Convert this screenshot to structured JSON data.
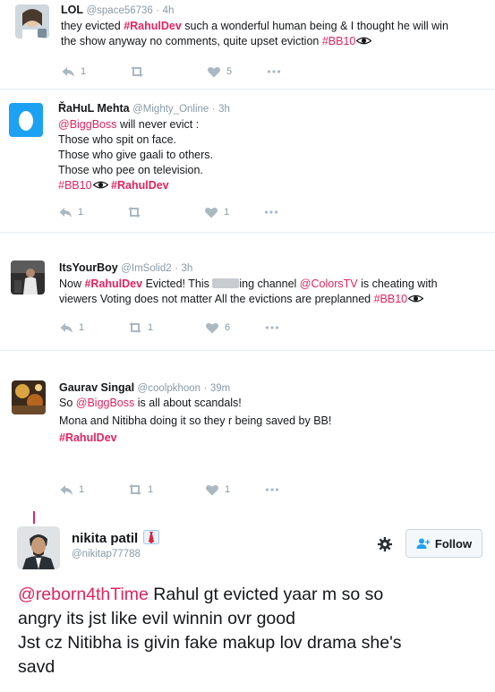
{
  "tweets": [
    {
      "name": "LOL",
      "handle": "@space56736",
      "time": "4h",
      "lines": [
        [
          {
            "t": "they evicted ",
            "c": "text"
          },
          {
            "t": "#RahulDev",
            "c": "hl"
          },
          {
            "t": " such a wonderful human being & I thought he will win",
            "c": "text"
          }
        ],
        [
          {
            "t": "the show anyway no comments, quite upset eviction ",
            "c": "text"
          },
          {
            "t": "#BB10",
            "c": "mention"
          },
          {
            "t": "",
            "c": "eye"
          }
        ]
      ],
      "reply_count": "1",
      "retweet_count": "",
      "like_count": "5"
    },
    {
      "name": "ŘaHuL Mehta",
      "handle": "@Mighty_Online",
      "time": "3h",
      "lines": [
        [
          {
            "t": "@BiggBoss",
            "c": "mention"
          },
          {
            "t": " will never evict :",
            "c": "text"
          }
        ],
        [
          {
            "t": "Those who spit on face.",
            "c": "text"
          }
        ],
        [
          {
            "t": "Those who give gaali to others.",
            "c": "text"
          }
        ],
        [
          {
            "t": "Those who pee on television.",
            "c": "text"
          }
        ],
        [
          {
            "t": "#BB10",
            "c": "mention"
          },
          {
            "t": "",
            "c": "eye"
          },
          {
            "t": " ",
            "c": "text"
          },
          {
            "t": "#RahulDev",
            "c": "hl"
          }
        ]
      ],
      "reply_count": "1",
      "retweet_count": "",
      "like_count": "1"
    },
    {
      "name": "ItsYourBoy",
      "handle": "@ImSolid2",
      "time": "3h",
      "lines": [
        [
          {
            "t": "Now ",
            "c": "text"
          },
          {
            "t": "#RahulDev",
            "c": "hl"
          },
          {
            "t": " Evicted! This ",
            "c": "text"
          },
          {
            "t": "",
            "c": "censor"
          },
          {
            "t": "ing channel ",
            "c": "text"
          },
          {
            "t": "@ColorsTV",
            "c": "mention"
          },
          {
            "t": " is cheating with",
            "c": "text"
          }
        ],
        [
          {
            "t": "viewers Voting does not matter All the evictions are preplanned ",
            "c": "text"
          },
          {
            "t": "#BB10",
            "c": "mention"
          },
          {
            "t": "",
            "c": "eye"
          }
        ]
      ],
      "reply_count": "1",
      "retweet_count": "1",
      "like_count": "6"
    },
    {
      "name": "Gaurav Singal",
      "handle": "@coolpkhoon",
      "time": "39m",
      "lines": [
        [
          {
            "t": "So ",
            "c": "text"
          },
          {
            "t": "@BiggBoss",
            "c": "mention"
          },
          {
            "t": " is all about scandals!",
            "c": "text"
          }
        ],
        [
          {
            "t": " ",
            "c": "text"
          }
        ],
        [
          {
            "t": "Mona and Nitibha doing it so they r being saved by BB!",
            "c": "text"
          }
        ],
        [
          {
            "t": " ",
            "c": "text"
          }
        ],
        [
          {
            "t": "#RahulDev",
            "c": "hl"
          }
        ]
      ],
      "reply_count": "1",
      "retweet_count": "1",
      "like_count": "1"
    }
  ],
  "embedded": {
    "name": "nikita patil",
    "handle": "@nikitap77788",
    "follow_label": "Follow",
    "lines": [
      [
        {
          "t": "@reborn4thTime",
          "c": "mention"
        },
        {
          "t": " Rahul gt evicted yaar m so so",
          "c": "text"
        }
      ],
      [
        {
          "t": "angry its jst like evil winnin ovr good",
          "c": "text"
        }
      ],
      [
        {
          "t": "Jst cz Nitibha is givin fake makup lov drama she's",
          "c": "text"
        }
      ],
      [
        {
          "t": "savd",
          "c": "text"
        }
      ]
    ]
  },
  "colors": {
    "accent": "#e0245e",
    "muted": "#8899a6",
    "text": "#14171a",
    "border": "#e6ecf0"
  },
  "icons": [
    "reply-icon",
    "retweet-icon",
    "like-icon",
    "more-icon",
    "eye-emoji-icon",
    "gear-icon",
    "follow-person-icon",
    "verified-badge-icon"
  ]
}
